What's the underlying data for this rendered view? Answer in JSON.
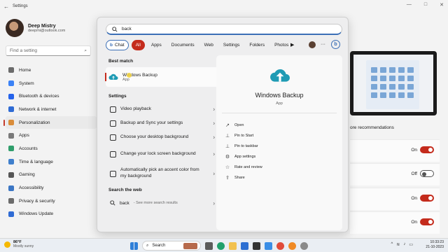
{
  "window": {
    "title": "Settings"
  },
  "profile": {
    "name": "Deep Mistry",
    "email": "deepmi@outlook.com"
  },
  "find": {
    "placeholder": "Find a setting"
  },
  "nav": [
    {
      "label": "Home",
      "icon": "home-icon",
      "color": "#6b6b6b"
    },
    {
      "label": "System",
      "icon": "system-icon",
      "color": "#3b82f6"
    },
    {
      "label": "Bluetooth & devices",
      "icon": "bluetooth-icon",
      "color": "#2563eb"
    },
    {
      "label": "Network & internet",
      "icon": "network-icon",
      "color": "#2f6bd4"
    },
    {
      "label": "Personalization",
      "icon": "brush-icon",
      "color": "#d98c3a",
      "active": true
    },
    {
      "label": "Apps",
      "icon": "apps-icon",
      "color": "#7a7a7a"
    },
    {
      "label": "Accounts",
      "icon": "accounts-icon",
      "color": "#2f9e6b"
    },
    {
      "label": "Time & language",
      "icon": "time-icon",
      "color": "#3f7fcc"
    },
    {
      "label": "Gaming",
      "icon": "gaming-icon",
      "color": "#555555"
    },
    {
      "label": "Accessibility",
      "icon": "accessibility-icon",
      "color": "#3b76c4"
    },
    {
      "label": "Privacy & security",
      "icon": "shield-icon",
      "color": "#6b6b6b"
    },
    {
      "label": "Windows Update",
      "icon": "update-icon",
      "color": "#2f6bd4"
    }
  ],
  "right": {
    "more_recommendations": "ore recommendations",
    "toggles": [
      {
        "state": "On",
        "on": true
      },
      {
        "state": "Off",
        "on": false
      },
      {
        "state": "On",
        "on": true
      },
      {
        "state": "On",
        "on": true
      }
    ]
  },
  "search": {
    "query": "back",
    "chips": [
      "Chat",
      "All",
      "Apps",
      "Documents",
      "Web",
      "Settings",
      "Folders",
      "Photos"
    ],
    "best_match_header": "Best match",
    "best_match": {
      "name": "Windows Backup",
      "type": "App"
    },
    "settings_header": "Settings",
    "settings": [
      {
        "text": "Video playback"
      },
      {
        "text": "Backup and Sync your settings"
      },
      {
        "text": "Choose your desktop background"
      },
      {
        "text": "Change your lock screen background"
      },
      {
        "text": "Automatically pick an accent color from my background"
      }
    ],
    "web_header": "Search the web",
    "web": {
      "query": "back",
      "more": "- See more search results"
    },
    "detail": {
      "title": "Windows Backup",
      "type": "App",
      "actions": [
        {
          "label": "Open",
          "icon": "open-icon"
        },
        {
          "label": "Pin to Start",
          "icon": "pin-icon"
        },
        {
          "label": "Pin to taskbar",
          "icon": "pin-taskbar-icon"
        },
        {
          "label": "App settings",
          "icon": "gear-icon"
        },
        {
          "label": "Rate and review",
          "icon": "star-icon"
        },
        {
          "label": "Share",
          "icon": "share-icon"
        }
      ]
    }
  },
  "taskbar": {
    "temp": "86°F",
    "weather": "Mostly sunny",
    "search_label": "Search",
    "time": "10:33:23",
    "date": "21-10-2023"
  },
  "colors": {
    "accent": "#c42b1c",
    "blue": "#3b6fb6"
  }
}
